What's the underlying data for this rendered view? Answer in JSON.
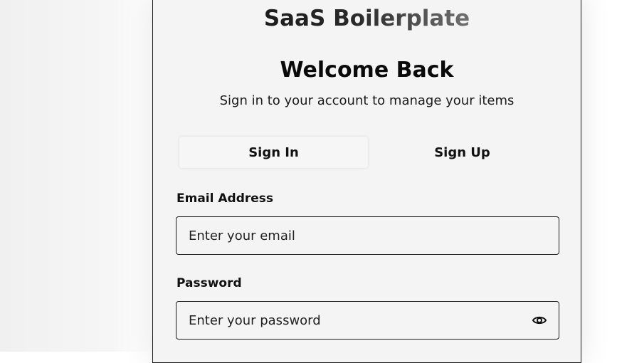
{
  "brand": {
    "name": "SaaS Boilerplate"
  },
  "header": {
    "title": "Welcome Back",
    "subtitle": "Sign in to your account to manage your items"
  },
  "tabs": [
    {
      "label": "Sign In",
      "active": true
    },
    {
      "label": "Sign Up",
      "active": false
    }
  ],
  "form": {
    "email": {
      "label": "Email Address",
      "placeholder": "Enter your email",
      "value": ""
    },
    "password": {
      "label": "Password",
      "placeholder": "Enter your password",
      "value": "",
      "toggle_icon": "eye-icon"
    }
  }
}
